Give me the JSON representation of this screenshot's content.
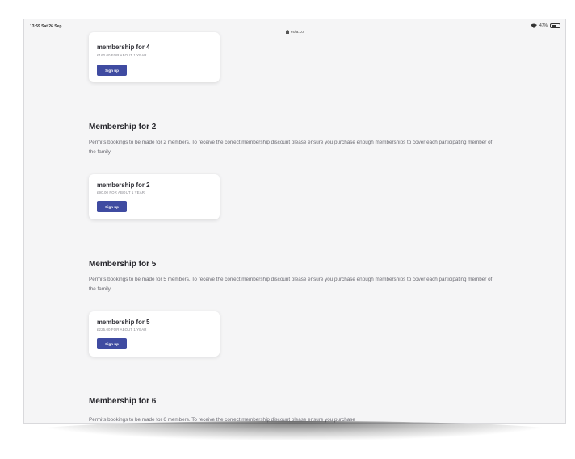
{
  "status_bar": {
    "time": "13:59  Sat 26 Sep",
    "url": "eola.co",
    "battery": "47%"
  },
  "icons": {
    "wifi": "wifi-icon",
    "battery": "battery-icon",
    "lock": "lock-icon"
  },
  "colors": {
    "button": "#3f4ba1",
    "background": "#f5f5f6",
    "card": "#ffffff"
  },
  "sections": [
    {
      "title": "",
      "description": "",
      "card": {
        "title": "membership for 4",
        "price": "£160.00 FOR ABOUT 1 YEAR",
        "button": "Sign up"
      }
    },
    {
      "title": "Membership for 2",
      "description": "Permits bookings to be made for 2 members. To receive the correct membership discount please ensure you purchase enough memberships to cover each participating member of the family.",
      "card": {
        "title": "membership for 2",
        "price": "£90.00 FOR ABOUT 1 YEAR",
        "button": "Sign up"
      }
    },
    {
      "title": "Membership for 5",
      "description": "Permits bookings to be made for 5 members. To receive the correct membership discount please ensure you purchase enough memberships to cover each participating member of the family.",
      "card": {
        "title": "membership for 5",
        "price": "£225.00 FOR ABOUT 1 YEAR",
        "button": "Sign up"
      }
    },
    {
      "title": "Membership for 6",
      "description": "Permits bookings to be made for 6 members. To receive the correct membership discount please ensure you purchase",
      "card": null
    }
  ]
}
